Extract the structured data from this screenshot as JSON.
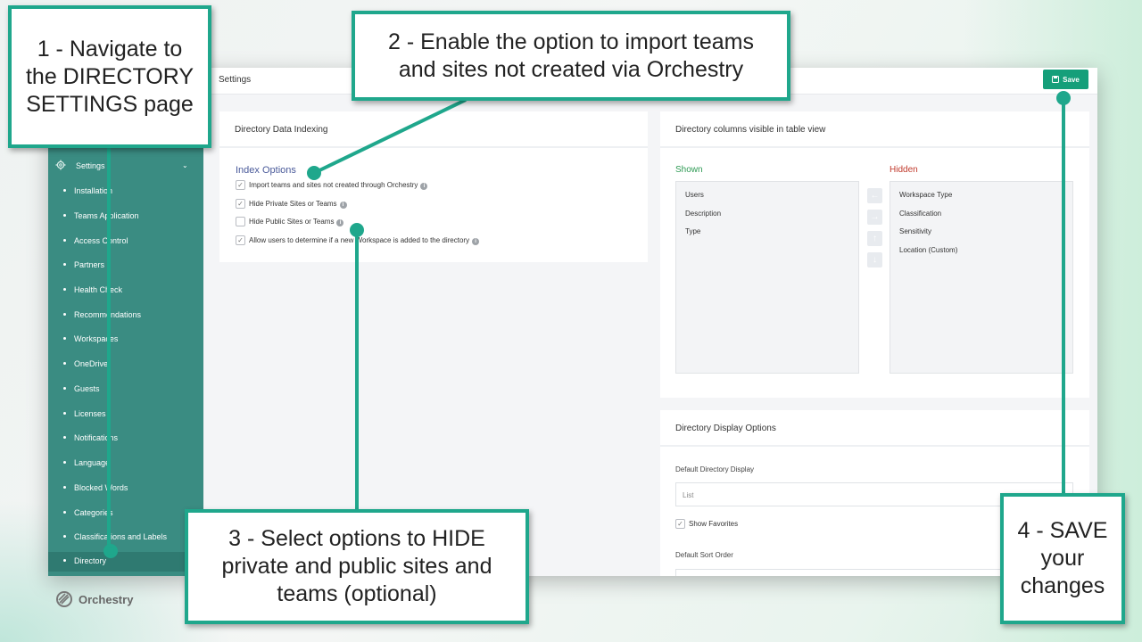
{
  "app": {
    "page_title": "Settings",
    "save_label": "Save"
  },
  "sidebar": {
    "settings_label": "Settings",
    "items": [
      {
        "label": "Installation"
      },
      {
        "label": "Teams Application"
      },
      {
        "label": "Access Control"
      },
      {
        "label": "Partners"
      },
      {
        "label": "Health Check"
      },
      {
        "label": "Recommendations"
      },
      {
        "label": "Workspaces"
      },
      {
        "label": "OneDrive"
      },
      {
        "label": "Guests"
      },
      {
        "label": "Licenses"
      },
      {
        "label": "Notifications"
      },
      {
        "label": "Language"
      },
      {
        "label": "Blocked Words"
      },
      {
        "label": "Categories"
      },
      {
        "label": "Classifications and Labels"
      },
      {
        "label": "Directory"
      }
    ],
    "logo_text": "Orchestry"
  },
  "indexing": {
    "panel_title": "Directory Data Indexing",
    "section_title": "Index Options",
    "options": [
      {
        "label": "Import teams and sites not created through Orchestry",
        "checked": true
      },
      {
        "label": "Hide Private Sites or Teams",
        "checked": true
      },
      {
        "label": "Hide Public Sites or Teams",
        "checked": false
      },
      {
        "label": "Allow users to determine if a new Workspace is added to the directory",
        "checked": true
      }
    ]
  },
  "columns": {
    "panel_title": "Directory columns visible in table view",
    "shown_label": "Shown",
    "hidden_label": "Hidden",
    "shown": [
      "Users",
      "Description",
      "Type"
    ],
    "hidden": [
      "Workspace Type",
      "Classification",
      "Sensitivity",
      "Location (Custom)"
    ],
    "shown_color": "#2e9a54",
    "hidden_color": "#c0392b"
  },
  "display": {
    "panel_title": "Directory Display Options",
    "default_display_label": "Default Directory Display",
    "default_display_value": "List",
    "show_favorites_label": "Show Favorites",
    "show_favorites_checked": true,
    "sort_order_label": "Default Sort Order"
  },
  "callouts": {
    "step1": "1 - Navigate to the DIRECTORY SETTINGS page",
    "step2": "2 - Enable the option to import teams and sites not created via Orchestry",
    "step3": "3 - Select options to HIDE private and public sites and teams (optional)",
    "step4": "4 - SAVE your changes"
  },
  "accent_color": "#1fa78c"
}
